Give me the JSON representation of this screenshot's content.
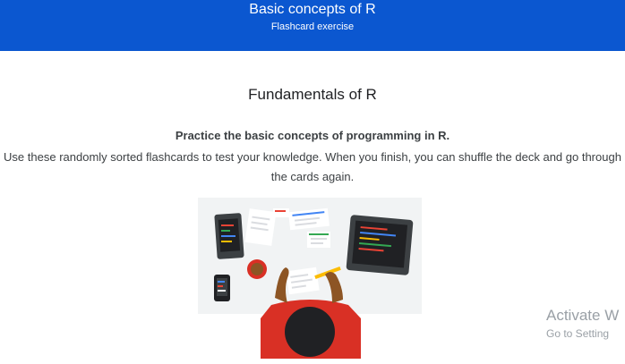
{
  "header": {
    "title": "Basic concepts of R",
    "subtitle": "Flashcard exercise"
  },
  "main": {
    "section_title": "Fundamentals of R",
    "intro_bold": "Practice the basic concepts of programming in R.",
    "intro_text": "Use these randomly sorted flashcards to test your knowledge. When you finish, you can shuffle the deck and go through the cards again."
  },
  "watermark": {
    "line1": "Activate W",
    "line2": "Go to Setting"
  },
  "colors": {
    "header_bg": "#0b57d0",
    "illustration_bg": "#f1f3f4",
    "shirt_red": "#d93025"
  }
}
